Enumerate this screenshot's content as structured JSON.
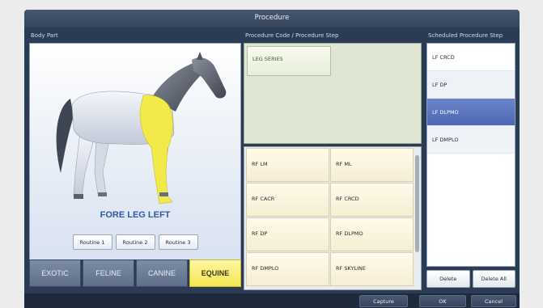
{
  "dialog": {
    "title": "Procedure"
  },
  "sections": {
    "body_part": "Body Part",
    "procedure_code": "Procedure Code / Procedure Step",
    "scheduled": "Scheduled Procedure Step"
  },
  "body_part": {
    "selected_name": "FORE LEG LEFT",
    "highlight_color": "#f2ea4a",
    "routines": [
      "Routine 1",
      "Routine 2",
      "Routine 3"
    ]
  },
  "species_tabs": [
    {
      "label": "EXOTIC",
      "active": false
    },
    {
      "label": "FELINE",
      "active": false
    },
    {
      "label": "CANINE",
      "active": false
    },
    {
      "label": "EQUINE",
      "active": true
    }
  ],
  "procedure_codes": {
    "series": [
      "LEG SERIES"
    ],
    "steps": [
      "RF LM",
      "RF ML",
      "RF CACR",
      "RF CRCD",
      "RF DP",
      "RF DLPMO",
      "RF DMPLO",
      "RF SKYLINE"
    ]
  },
  "scheduled_steps": {
    "items": [
      "LF CRCD",
      "LF DP",
      "LF DLPMO",
      "LF DMPLO"
    ],
    "selected": "LF DLPMO",
    "delete_label": "Delete",
    "delete_all_label": "Delete All"
  },
  "footer": {
    "capture_label": "Capture",
    "ok_label": "OK",
    "cancel_label": "Cancel"
  }
}
